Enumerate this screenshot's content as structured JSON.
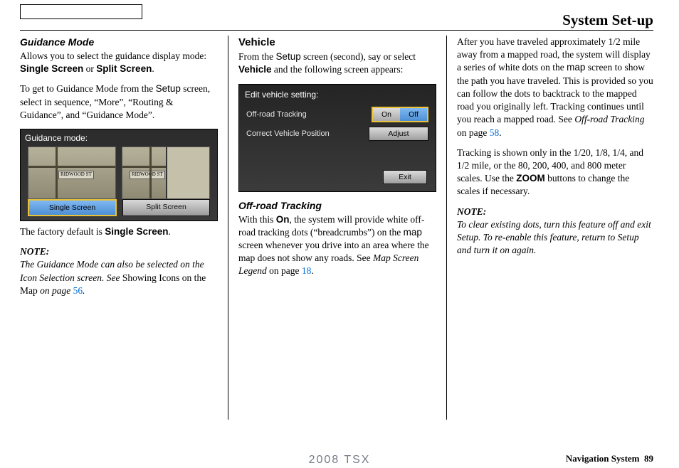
{
  "page": {
    "title": "System Set-up",
    "footer_model": "2008 TSX",
    "footer_label": "Navigation System",
    "footer_pageno": "89"
  },
  "col1": {
    "h_guidance": "Guidance Mode",
    "p1a": "Allows you to select the guidance display mode: ",
    "p1b_single": "Single Screen",
    "p1c": " or ",
    "p1d_split": "Split Screen",
    "p1e": ".",
    "p2a": "To get to Guidance Mode from the ",
    "p2b_setup": "Setup",
    "p2c": " screen, select in sequence, “More”, “Routing & Guidance”, and “Guidance Mode”.",
    "scr_title": "Guidance mode:",
    "btn_single": "Single Screen",
    "btn_split": "Split Screen",
    "p3a": "The factory default is ",
    "p3b_bold": "Single Screen",
    "p3c": ".",
    "note_label": "NOTE:",
    "note_a": "The Guidance Mode can also be selected on the Icon Selection screen. See ",
    "note_b_plain": "Showing Icons on the Map",
    "note_c": " on page ",
    "note_page": "56",
    "note_d": "."
  },
  "col2": {
    "h_vehicle": "Vehicle",
    "p1a": "From the ",
    "p1b_setup": "Setup",
    "p1c": " screen (second), say or select ",
    "p1d_vehicle": "Vehicle",
    "p1e": " and the following screen appears:",
    "scr_title": "Edit vehicle setting:",
    "row1_label": "Off-road Tracking",
    "row1_on": "On",
    "row1_off": "Off",
    "row2_label": "Correct Vehicle Position",
    "row2_btn": "Adjust",
    "exit": "Exit",
    "h_offroad": "Off-road Tracking",
    "p2a": "With this ",
    "p2b_on": "On",
    "p2c": ", the system will provide white off-road tracking dots (“breadcrumbs”) on the ",
    "p2d_map": "map",
    "p2e": " screen whenever you drive into an area where the map does not show any roads. See ",
    "p2f_ital": "Map Screen Legend",
    "p2g": " on page ",
    "p2h_link": "18",
    "p2i": "."
  },
  "col3": {
    "p1a": "After you have traveled approximately 1/2 mile away from a mapped road, the system will display a series of white dots on the ",
    "p1b_map": "map",
    "p1c": " screen to show the path you have traveled. This is provided so you can follow the dots to backtrack to the mapped road you originally left. Tracking continues until you reach a mapped road. See ",
    "p1d_ital": "Off-road Tracking",
    "p1e": " on page ",
    "p1f_link": "58",
    "p1g": ".",
    "p2a": "Tracking is shown only in the 1/20, 1/8, 1/4, and 1/2 mile, or the 80, 200, 400, and 800 meter scales. Use the ",
    "p2b_zoom": "ZOOM",
    "p2c": " buttons to change the scales if necessary.",
    "note_label": "NOTE:",
    "note_body": "To clear existing dots, turn this feature off and exit Setup. To re-enable this feature, return to Setup and turn it on again."
  }
}
